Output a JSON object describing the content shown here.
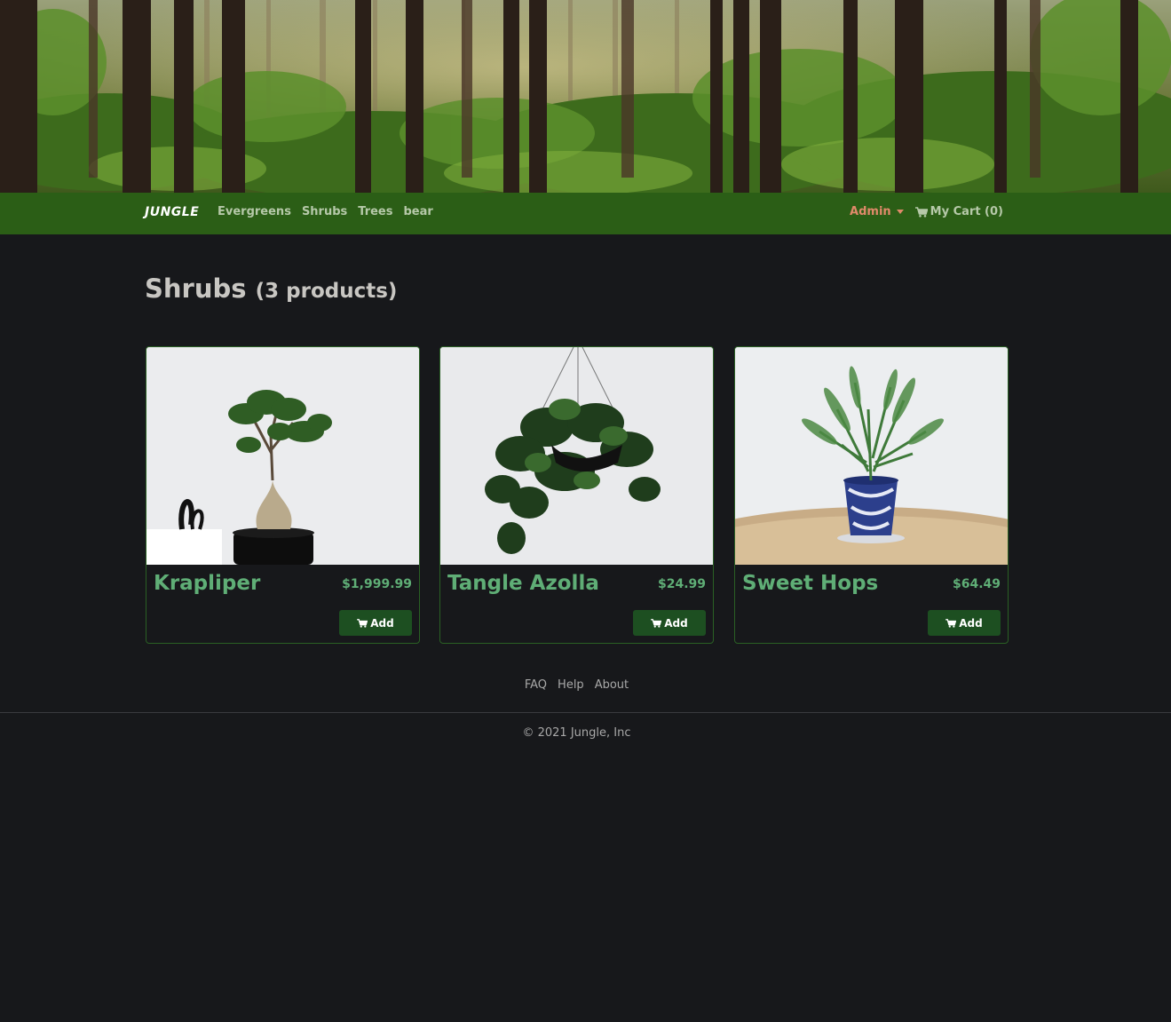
{
  "navbar": {
    "brand": "JUNGLE",
    "links": [
      "Evergreens",
      "Shrubs",
      "Trees",
      "bear"
    ],
    "admin_label": "Admin",
    "cart_label": "My Cart (0)"
  },
  "heading": {
    "title": "Shrubs",
    "count": "(3 products)"
  },
  "products": [
    {
      "name": "Krapliper",
      "price": "$1,999.99",
      "add_label": "Add"
    },
    {
      "name": "Tangle Azolla",
      "price": "$24.99",
      "add_label": "Add"
    },
    {
      "name": "Sweet Hops",
      "price": "$64.49",
      "add_label": "Add"
    }
  ],
  "footer": {
    "links": [
      "FAQ",
      "Help",
      "About"
    ],
    "copyright": "© 2021 Jungle, Inc"
  },
  "colors": {
    "navbar_bg": "#2b5e16",
    "page_bg": "#17181b",
    "product_text": "#5fae76",
    "button_bg": "#1d4f21",
    "admin": "#e08a6a"
  },
  "icons": {
    "cart": "shopping-cart-icon",
    "admin_caret": "caret-down-icon"
  }
}
